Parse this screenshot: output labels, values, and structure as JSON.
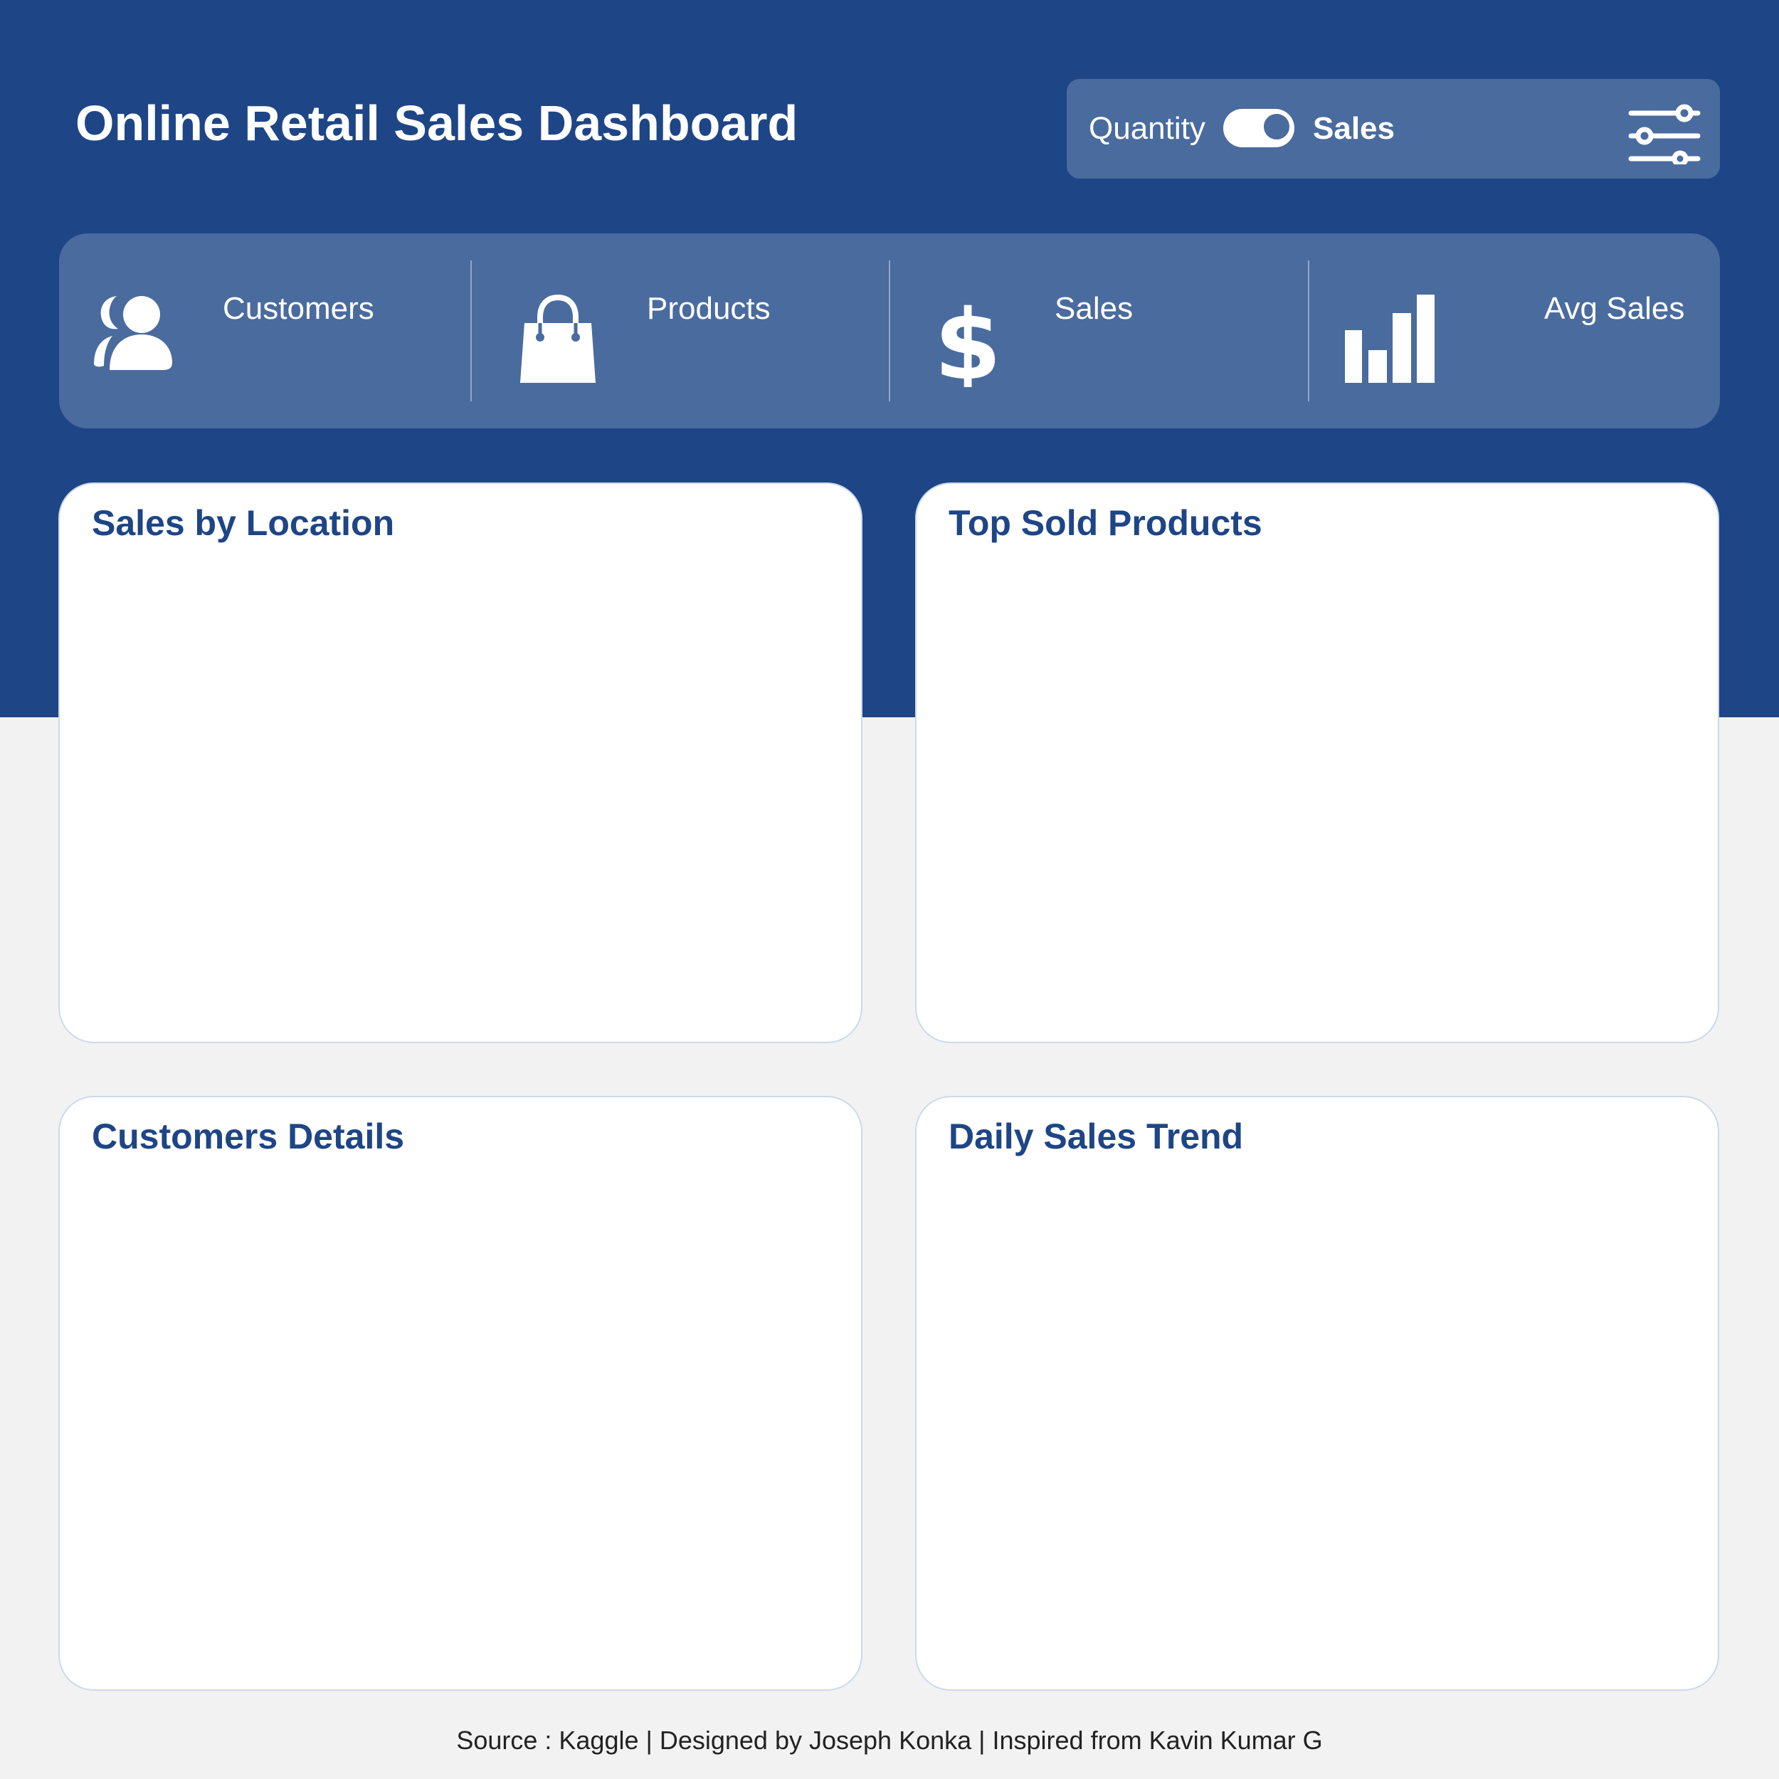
{
  "header": {
    "title": "Online Retail Sales Dashboard"
  },
  "controls": {
    "toggle_left_label": "Quantity",
    "toggle_right_label": "Sales",
    "toggle_state": "Sales",
    "filter_icon": "sliders-icon"
  },
  "kpis": [
    {
      "label": "Customers",
      "icon": "users-icon"
    },
    {
      "label": "Products",
      "icon": "shopping-bag-icon"
    },
    {
      "label": "Sales",
      "icon": "dollar-icon"
    },
    {
      "label": "Avg Sales",
      "icon": "bar-chart-icon"
    }
  ],
  "cards": [
    {
      "title": "Sales by Location"
    },
    {
      "title": "Top Sold Products"
    },
    {
      "title": "Customers Details"
    },
    {
      "title": "Daily Sales Trend"
    }
  ],
  "footer": {
    "text": "Source : Kaggle |  Designed by Joseph Konka | Inspired from Kavin Kumar G"
  },
  "colors": {
    "primary": "#1e4586",
    "panel": "#4a6b9e",
    "background": "#f2f2f2",
    "card": "#ffffff"
  }
}
